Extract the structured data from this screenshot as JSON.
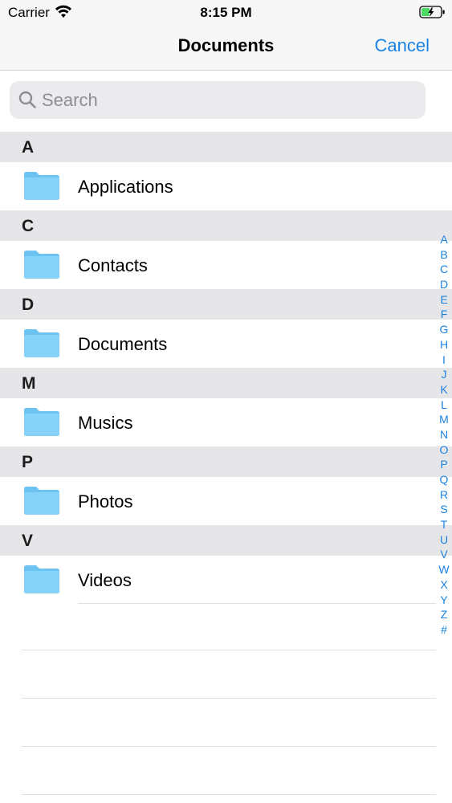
{
  "status_bar": {
    "carrier": "Carrier",
    "time": "8:15 PM"
  },
  "nav": {
    "title": "Documents",
    "cancel_label": "Cancel"
  },
  "search": {
    "placeholder": "Search"
  },
  "sections": [
    {
      "letter": "A",
      "items": [
        "Applications"
      ]
    },
    {
      "letter": "C",
      "items": [
        "Contacts"
      ]
    },
    {
      "letter": "D",
      "items": [
        "Documents"
      ]
    },
    {
      "letter": "M",
      "items": [
        "Musics"
      ]
    },
    {
      "letter": "P",
      "items": [
        "Photos"
      ]
    },
    {
      "letter": "V",
      "items": [
        "Videos"
      ]
    }
  ],
  "index_letters": [
    "A",
    "B",
    "C",
    "D",
    "E",
    "F",
    "G",
    "H",
    "I",
    "J",
    "K",
    "L",
    "M",
    "N",
    "O",
    "P",
    "Q",
    "R",
    "S",
    "T",
    "U",
    "V",
    "W",
    "X",
    "Y",
    "Z",
    "#"
  ],
  "colors": {
    "accent": "#1a82e2",
    "folder": "#7fcff8",
    "section_bg": "#e6e6e8",
    "battery_green": "#4cd964"
  },
  "icons": {
    "row_icon": "folder-icon",
    "search": "search-icon",
    "wifi": "wifi-icon",
    "battery": "battery-charging-icon"
  }
}
